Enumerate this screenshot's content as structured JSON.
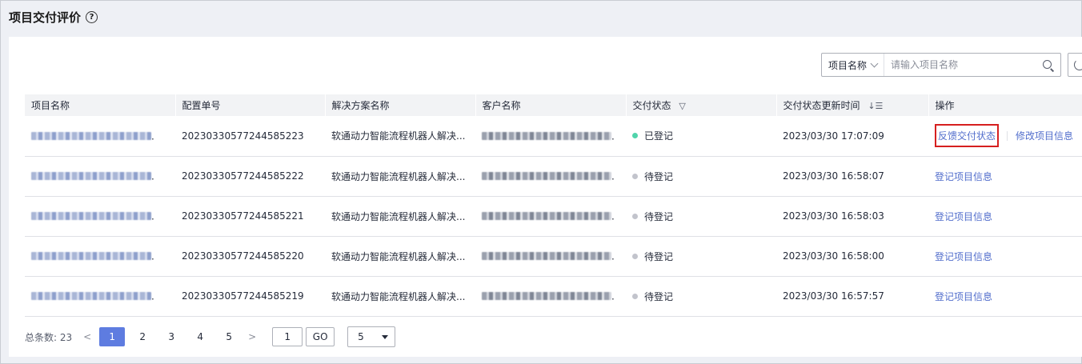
{
  "page": {
    "title": "项目交付评价",
    "help_icon": "?"
  },
  "search": {
    "field_label": "项目名称",
    "placeholder": "请输入项目名称"
  },
  "table": {
    "columns": [
      "项目名称",
      "配置单号",
      "解决方案名称",
      "客户名称",
      "交付状态",
      "交付状态更新时间",
      "操作"
    ],
    "status_colors": {
      "已登记": "#50d4ab",
      "待登记": "#c2c4cc"
    },
    "rows": [
      {
        "config_no": "20230330577244585223",
        "solution": "软通动力智能流程机器人解决...",
        "status": "已登记",
        "updated": "2023/03/30 17:07:09",
        "actions": [
          "反馈交付状态",
          "修改项目信息"
        ]
      },
      {
        "config_no": "20230330577244585222",
        "solution": "软通动力智能流程机器人解决...",
        "status": "待登记",
        "updated": "2023/03/30 16:58:07",
        "actions": [
          "登记项目信息"
        ]
      },
      {
        "config_no": "20230330577244585221",
        "solution": "软通动力智能流程机器人解决...",
        "status": "待登记",
        "updated": "2023/03/30 16:58:03",
        "actions": [
          "登记项目信息"
        ]
      },
      {
        "config_no": "20230330577244585220",
        "solution": "软通动力智能流程机器人解决...",
        "status": "待登记",
        "updated": "2023/03/30 16:58:00",
        "actions": [
          "登记项目信息"
        ]
      },
      {
        "config_no": "20230330577244585219",
        "solution": "软通动力智能流程机器人解决...",
        "status": "待登记",
        "updated": "2023/03/30 16:57:57",
        "actions": [
          "登记项目信息"
        ]
      }
    ]
  },
  "pagination": {
    "total_label": "总条数:",
    "total": "23",
    "prev": "<",
    "next": ">",
    "pages": [
      "1",
      "2",
      "3",
      "4",
      "5"
    ],
    "current": "1",
    "jump_value": "1",
    "go_label": "GO",
    "page_size": "5"
  }
}
